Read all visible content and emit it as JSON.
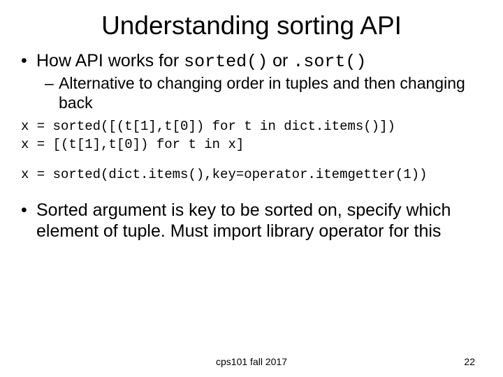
{
  "title": "Understanding sorting API",
  "bullet1_prefix": "How API works for ",
  "bullet1_code1": "sorted()",
  "bullet1_middle": " or ",
  "bullet1_code2": ".sort()",
  "sub1": "Alternative to changing order in tuples and then changing back",
  "code1": "x = sorted([(t[1],t[0]) for t in dict.items()])\nx = [(t[1],t[0]) for t in x]",
  "code2": "x = sorted(dict.items(),key=operator.itemgetter(1))",
  "bullet2": "Sorted argument is key to be sorted on, specify which element of tuple. Must import library operator for this",
  "footer_center": "cps101 fall 2017",
  "footer_right": "22"
}
